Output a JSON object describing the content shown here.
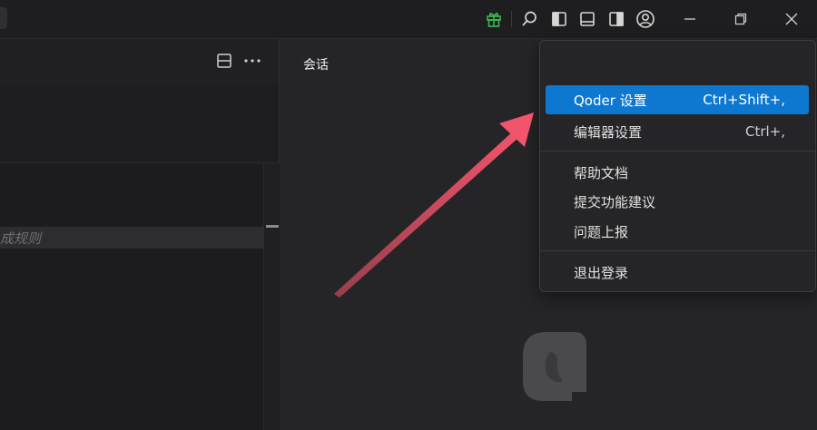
{
  "titlebar": {
    "icons": [
      "gift-icon",
      "search-icon",
      "toggle-left-sidebar-icon",
      "toggle-panel-icon",
      "toggle-right-sidebar-icon",
      "account-icon"
    ],
    "window_controls": [
      "minimize-icon",
      "restore-icon",
      "close-icon"
    ],
    "gift_color": "#3fb950"
  },
  "editor": {
    "rules_placeholder": "成规则",
    "header_icons": [
      "split-editor-icon",
      "more-actions-icon"
    ]
  },
  "chat": {
    "session_tab": "会话"
  },
  "menu": {
    "items": [
      {
        "label": "Qoder 设置",
        "shortcut": "Ctrl+Shift+,",
        "active": true
      },
      {
        "label": "编辑器设置",
        "shortcut": "Ctrl+,"
      },
      {
        "label": "帮助文档"
      },
      {
        "label": "提交功能建议"
      },
      {
        "label": "问题上报"
      },
      {
        "label": "退出登录"
      }
    ]
  },
  "colors": {
    "accent": "#0e78d0",
    "annotation_arrow": "#f2546a"
  }
}
